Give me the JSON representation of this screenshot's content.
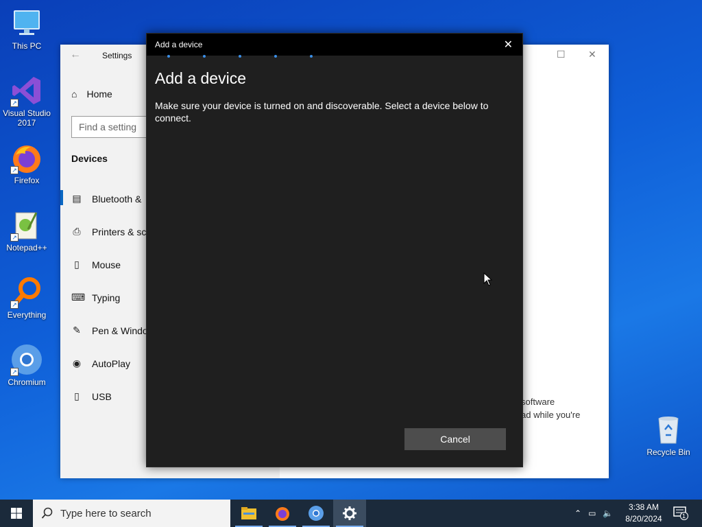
{
  "desktop": {
    "icons": [
      {
        "label": "This PC"
      },
      {
        "label": "Visual Studio 2017"
      },
      {
        "label": "Firefox"
      },
      {
        "label": "Notepad++"
      },
      {
        "label": "Everything"
      },
      {
        "label": "Chromium"
      },
      {
        "label": "Recycle Bin"
      }
    ]
  },
  "settings": {
    "title": "Settings",
    "home_label": "Home",
    "search_placeholder": "Find a setting",
    "section_heading": "Devices",
    "nav_items": [
      {
        "label": "Bluetooth &",
        "icon": "bluetooth-devices-icon"
      },
      {
        "label": "Printers & sc",
        "icon": "printer-icon"
      },
      {
        "label": "Mouse",
        "icon": "mouse-icon"
      },
      {
        "label": "Typing",
        "icon": "keyboard-icon"
      },
      {
        "label": "Pen & Windo",
        "icon": "pen-icon"
      },
      {
        "label": "AutoPlay",
        "icon": "autoplay-icon"
      },
      {
        "label": "USB",
        "icon": "usb-icon"
      }
    ],
    "bg_text_line1": "software",
    "bg_text_line2": "ad while you're"
  },
  "dialog": {
    "window_title": "Add a device",
    "heading": "Add a device",
    "description": "Make sure your device is turned on and discoverable. Select a device below to connect.",
    "cancel_label": "Cancel"
  },
  "taskbar": {
    "search_placeholder": "Type here to search",
    "apps": [
      "file-explorer-icon",
      "firefox-icon",
      "chromium-icon",
      "settings-icon"
    ],
    "time": "3:38 AM",
    "date": "8/20/2024",
    "notification_count": "1"
  },
  "colors": {
    "accent": "#0a67c2",
    "dialog_bg": "#1f1f1f",
    "taskbar_bg": "#1b2a3b"
  }
}
